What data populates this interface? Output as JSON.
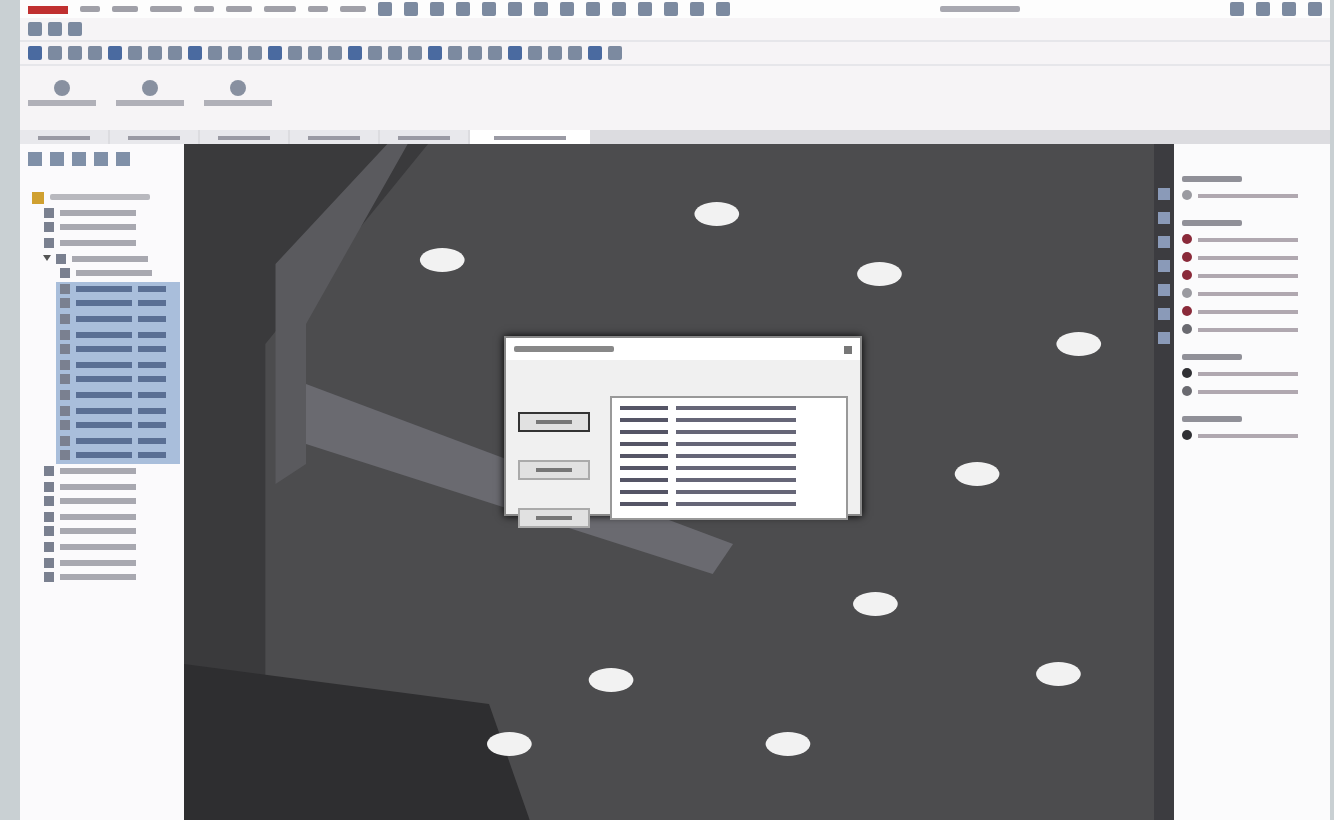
{
  "tabs": [
    {
      "selected": false
    },
    {
      "selected": false
    },
    {
      "selected": false
    },
    {
      "selected": false
    },
    {
      "selected": false
    },
    {
      "selected": true
    }
  ],
  "tree": {
    "items": [
      {
        "selected": false
      },
      {
        "selected": false
      },
      {
        "selected": false
      },
      {
        "selected": false,
        "expanded": true,
        "children": [
          {
            "selected": false
          },
          {
            "selected": true
          },
          {
            "selected": true
          },
          {
            "selected": true
          },
          {
            "selected": true
          },
          {
            "selected": true
          },
          {
            "selected": true
          },
          {
            "selected": true
          },
          {
            "selected": true
          },
          {
            "selected": true
          },
          {
            "selected": true
          },
          {
            "selected": true
          },
          {
            "selected": true
          }
        ]
      },
      {
        "selected": false
      },
      {
        "selected": false
      },
      {
        "selected": false
      },
      {
        "selected": false
      },
      {
        "selected": false
      },
      {
        "selected": false
      },
      {
        "selected": false
      },
      {
        "selected": false
      }
    ]
  },
  "dialog": {
    "buttons": [
      {
        "selected": true
      },
      {
        "selected": false
      },
      {
        "selected": false
      }
    ],
    "rows": [
      {
        "selected": false
      },
      {
        "selected": false
      },
      {
        "selected": false
      },
      {
        "selected": false
      },
      {
        "selected": false
      },
      {
        "selected": false
      },
      {
        "selected": false
      },
      {
        "selected": false
      },
      {
        "selected": false
      }
    ]
  },
  "task_pane": {
    "groups": [
      {
        "rows": [
          {
            "color": "#9a9aa0"
          }
        ]
      },
      {
        "rows": [
          {
            "color": "#8a2a3a"
          },
          {
            "color": "#8a2a3a"
          },
          {
            "color": "#8a2a3a"
          },
          {
            "color": "#9a9aa0"
          },
          {
            "color": "#8a2a3a"
          },
          {
            "color": "#6a6a70"
          }
        ]
      },
      {
        "rows": [
          {
            "color": "#303034"
          },
          {
            "color": "#6a6a70"
          }
        ]
      },
      {
        "rows": [
          {
            "color": "#303034"
          }
        ]
      }
    ]
  }
}
